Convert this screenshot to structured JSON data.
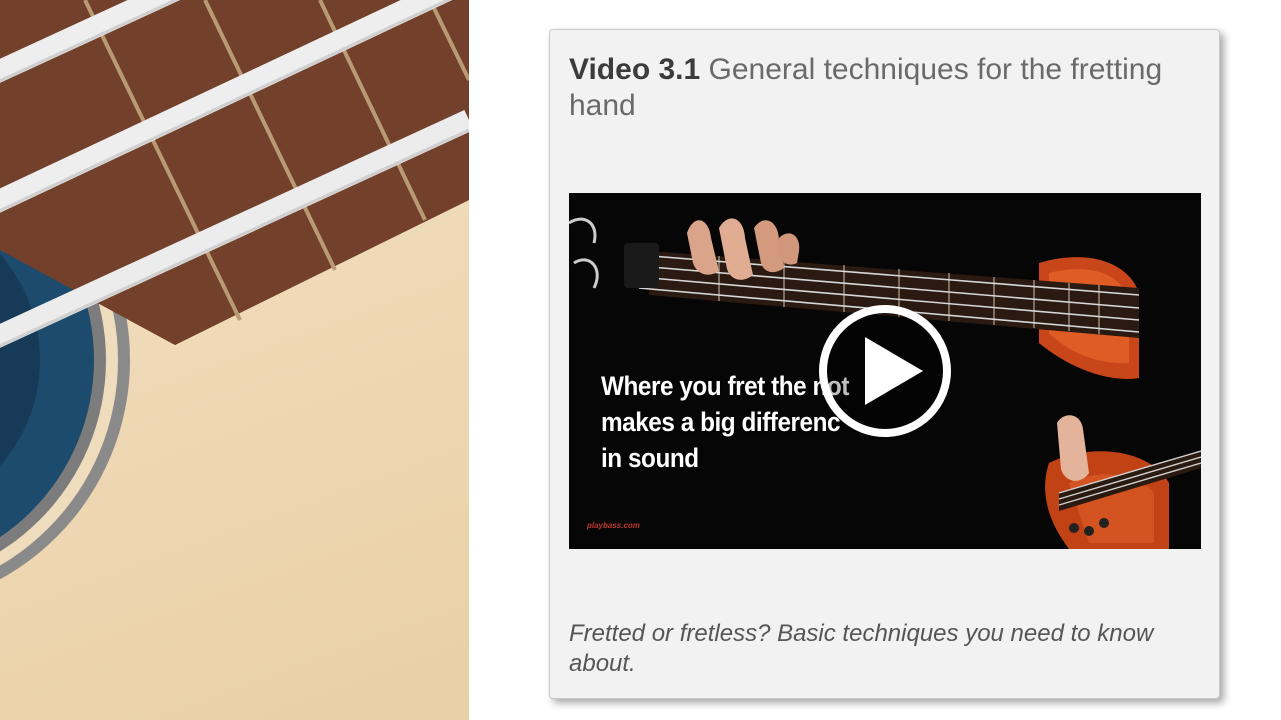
{
  "card": {
    "title_number": "Video 3.1",
    "title_text": "General techniques for the fretting hand",
    "caption": "Fretted or fretless? Basic techniques you need to know about."
  },
  "video": {
    "overlay_line1": "Where you fret the not",
    "overlay_line2": "makes a big differenc",
    "overlay_line3": "in sound",
    "watermark": "playbass.com",
    "play_icon": "play-icon"
  },
  "colors": {
    "card_background": "#f2f2f2",
    "title_number": "#3c3c3c",
    "title_text": "#6a6a6a",
    "caption": "#555555",
    "bass_body": "#d2501c"
  }
}
